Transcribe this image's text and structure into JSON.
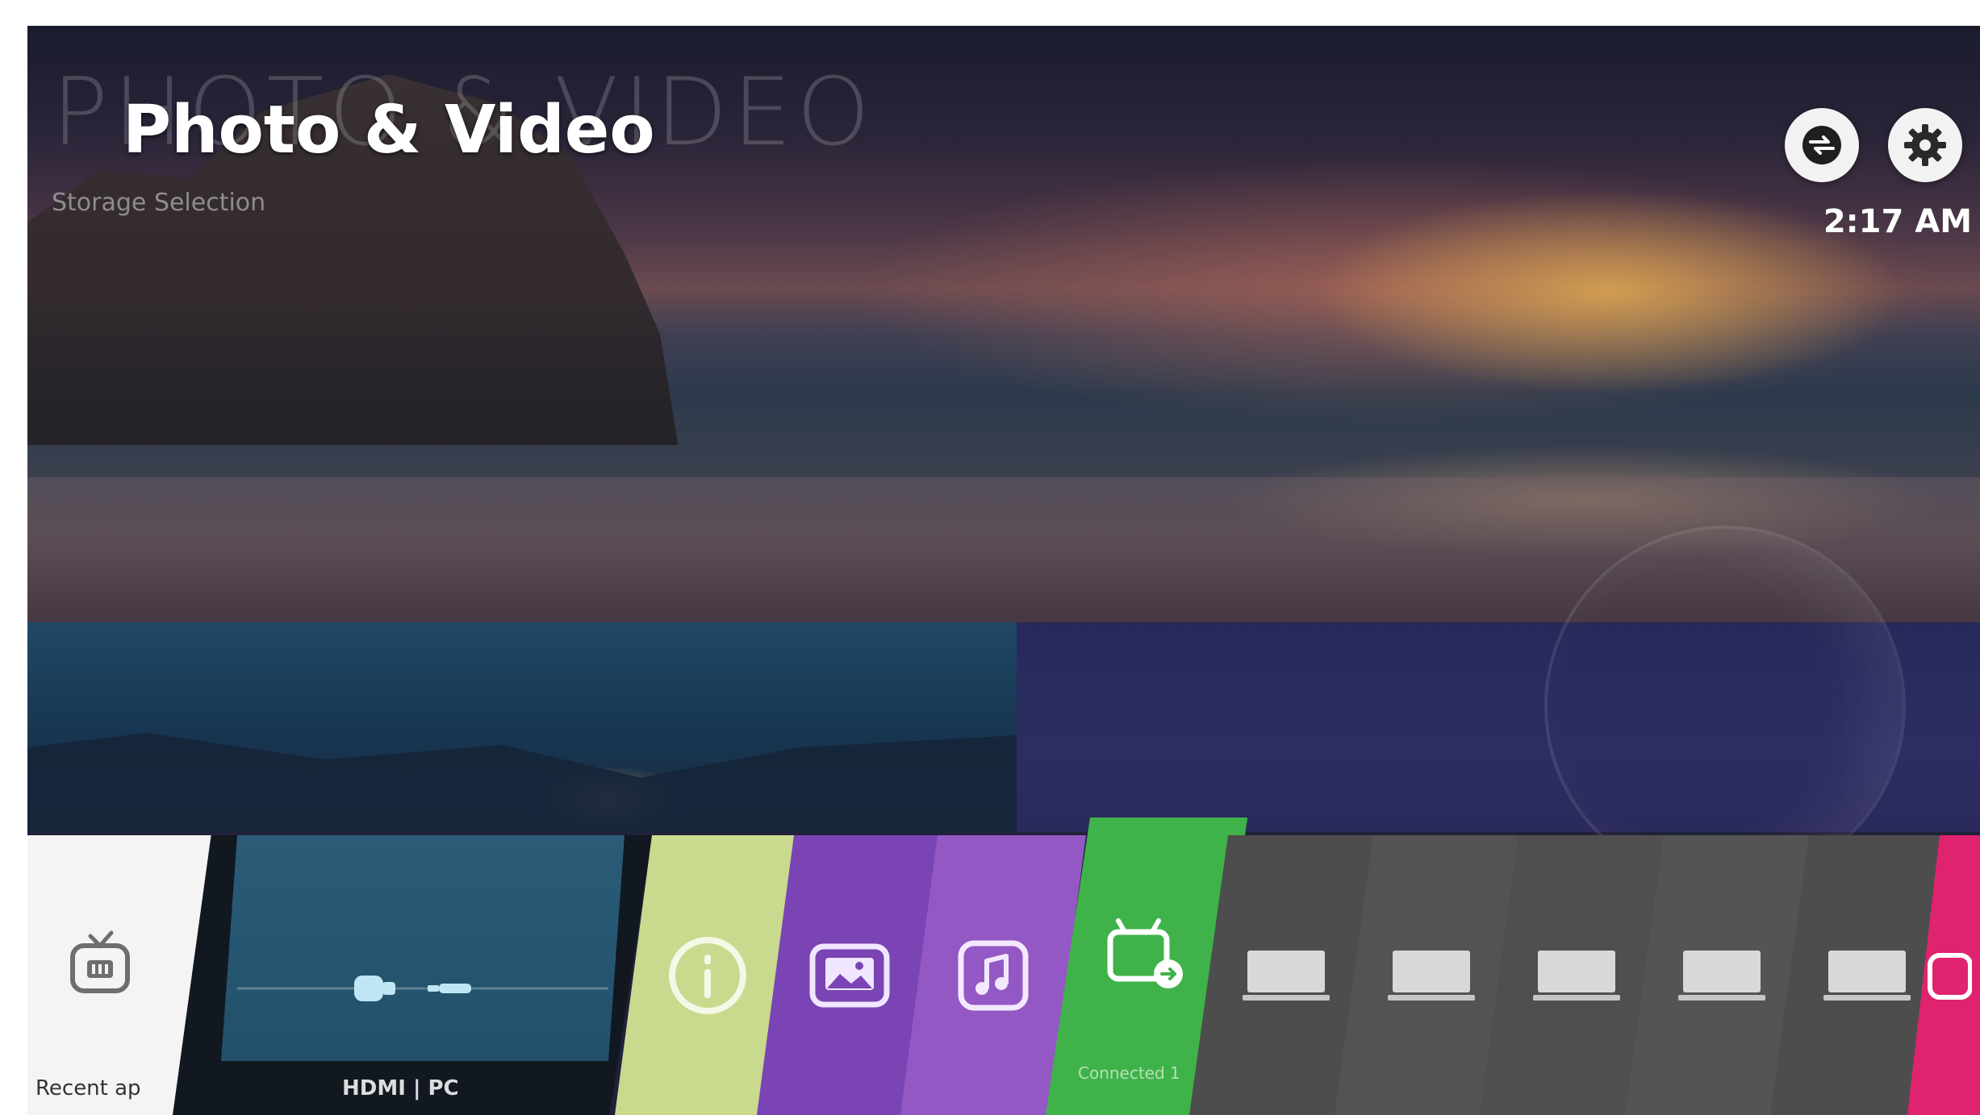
{
  "header": {
    "watermark": "PHOTO & VIDEO",
    "title": "Photo & Video",
    "subtitle": "Storage Selection"
  },
  "top_controls": {
    "input_icon": "input-switch-icon",
    "settings_icon": "gear-icon",
    "time": "2:17 AM"
  },
  "launcher": {
    "recent_label": "Recent ap",
    "recent_icon": "tv-icon",
    "hdmi_label": "HDMI | PC",
    "info_icon": "info-icon",
    "photo_icon": "photo-icon",
    "music_icon": "music-icon",
    "storage_icon": "media-storage-icon",
    "storage_label": "Connected 1",
    "device_icon": "laptop-icon",
    "pink_icon": "app-icon"
  },
  "colors": {
    "info_tile": "#c9d98e",
    "photo_tile": "#7a44b4",
    "music_tile": "#9358c4",
    "storage_tile": "#3fb34a",
    "device_tile": "#505050",
    "pink_tile": "#e0236f"
  }
}
